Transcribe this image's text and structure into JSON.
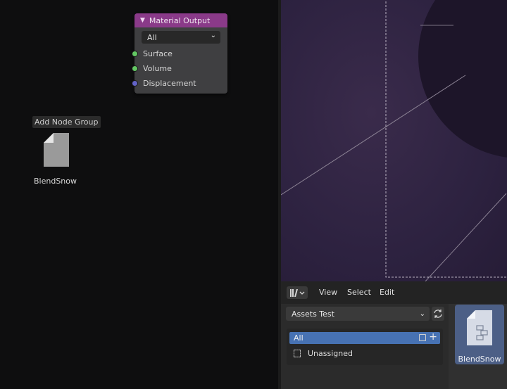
{
  "node_editor": {
    "material_output": {
      "title": "Material Output",
      "target_select": "All",
      "sockets": [
        "Surface",
        "Volume",
        "Displacement"
      ]
    },
    "drag_tooltip": "Add Node Group",
    "dragged_asset_name": "BlendSnow"
  },
  "asset_browser": {
    "menu": {
      "view": "View",
      "select": "Select",
      "edit": "Edit"
    },
    "library": "Assets Test",
    "catalogs": {
      "all": "All",
      "unassigned": "Unassigned"
    },
    "assets": [
      {
        "name": "BlendSnow"
      }
    ]
  },
  "colors": {
    "node_header": "#8a3a89",
    "catalog_selected": "#4772b3",
    "asset_selected": "#4c5f86"
  }
}
